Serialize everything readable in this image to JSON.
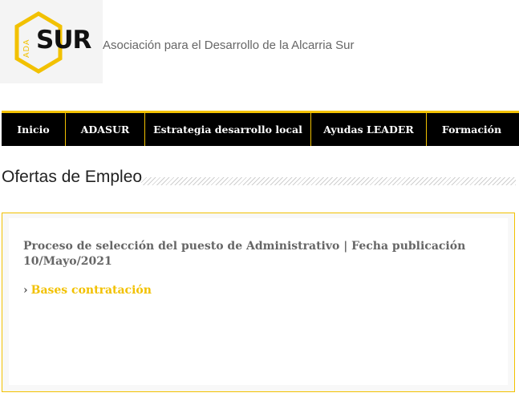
{
  "header": {
    "logo_ada": "ADA",
    "logo_sur": "SUR",
    "org_name": "Asociación para el Desarrollo de la Alcarria Sur"
  },
  "nav": {
    "items": [
      {
        "label": "Inicio"
      },
      {
        "label": "ADASUR"
      },
      {
        "label": "Estrategia desarrollo local"
      },
      {
        "label": "Ayudas LEADER"
      },
      {
        "label": "Formación"
      }
    ]
  },
  "main": {
    "title": "Ofertas de Empleo",
    "card": {
      "text": "Proceso de selección del puesto de Administrativo | Fecha publicación 10/Mayo/2021",
      "link_label": "Bases contratación",
      "link_chevron": "›"
    }
  },
  "colors": {
    "accent": "#f2c100",
    "nav_bg": "#000000",
    "text_gray": "#666666"
  }
}
